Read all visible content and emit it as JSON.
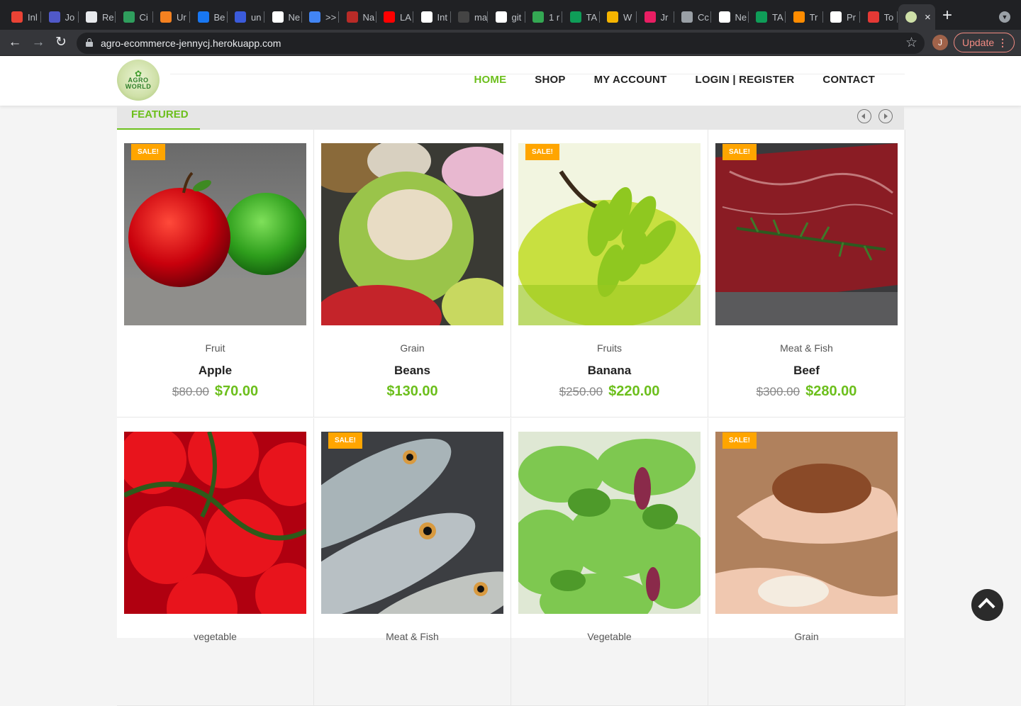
{
  "browser": {
    "tabs": [
      {
        "title": "Inl",
        "color": "#ea4335"
      },
      {
        "title": "Jo",
        "color": "#5059c9"
      },
      {
        "title": "Re",
        "color": "#e8eaed"
      },
      {
        "title": "Ci",
        "color": "#2f9e5d"
      },
      {
        "title": "Ur",
        "color": "#f48120"
      },
      {
        "title": "Be",
        "color": "#1877f2"
      },
      {
        "title": "un",
        "color": "#3b5bdb"
      },
      {
        "title": "Ne",
        "color": "#ffffff"
      },
      {
        "title": ">>",
        "color": "#4285f4"
      },
      {
        "title": "Na",
        "color": "#b92b27"
      },
      {
        "title": "LA",
        "color": "#ff0000"
      },
      {
        "title": "Int",
        "color": "#ffffff"
      },
      {
        "title": "ma",
        "color": "#444444"
      },
      {
        "title": "git",
        "color": "#ffffff"
      },
      {
        "title": "1 r",
        "color": "#34a853"
      },
      {
        "title": "TA",
        "color": "#0f9d58"
      },
      {
        "title": "W",
        "color": "#f5b400"
      },
      {
        "title": "Jr",
        "color": "#e91e63"
      },
      {
        "title": "Cc",
        "color": "#9aa0a6"
      },
      {
        "title": "Ne",
        "color": "#ffffff"
      },
      {
        "title": "TA",
        "color": "#0f9d58"
      },
      {
        "title": "Tr",
        "color": "#ff8c00"
      },
      {
        "title": "Pr",
        "color": "#ffffff"
      },
      {
        "title": "To",
        "color": "#e53935"
      }
    ],
    "active_tab_close": "×",
    "new_tab": "+",
    "url": "agro-ecommerce-jennycj.herokuapp.com",
    "profile_initial": "J",
    "update_label": "Update"
  },
  "site": {
    "logo_line1": "AGRO",
    "logo_line2": "WORLD",
    "nav": [
      {
        "label": "HOME",
        "active": true
      },
      {
        "label": "SHOP",
        "active": false
      },
      {
        "label": "MY ACCOUNT",
        "active": false
      },
      {
        "label": "LOGIN | REGISTER",
        "active": false
      },
      {
        "label": "CONTACT",
        "active": false
      }
    ],
    "accent_color": "#6cbf1c",
    "badge_color": "#ffa500"
  },
  "featured": {
    "tab_label": "FEATURED"
  },
  "products": [
    {
      "category": "Fruit",
      "name": "Apple",
      "old_price": "$80.00",
      "price": "$70.00",
      "sale": true,
      "sale_label": "SALE!",
      "image": "apples"
    },
    {
      "category": "Grain",
      "name": "Beans",
      "old_price": "",
      "price": "$130.00",
      "sale": false,
      "sale_label": "",
      "image": "beans"
    },
    {
      "category": "Fruits",
      "name": "Banana",
      "old_price": "$250.00",
      "price": "$220.00",
      "sale": true,
      "sale_label": "SALE!",
      "image": "bananas"
    },
    {
      "category": "Meat & Fish",
      "name": "Beef",
      "old_price": "$300.00",
      "price": "$280.00",
      "sale": true,
      "sale_label": "SALE!",
      "image": "beef"
    },
    {
      "category": "vegetable",
      "name": "",
      "old_price": "",
      "price": "",
      "sale": false,
      "sale_label": "",
      "image": "tomatoes"
    },
    {
      "category": "Meat & Fish",
      "name": "",
      "old_price": "",
      "price": "",
      "sale": true,
      "sale_label": "SALE!",
      "image": "fish"
    },
    {
      "category": "Vegetable",
      "name": "",
      "old_price": "",
      "price": "",
      "sale": false,
      "sale_label": "",
      "image": "lettuce"
    },
    {
      "category": "Grain",
      "name": "",
      "old_price": "",
      "price": "",
      "sale": true,
      "sale_label": "SALE!",
      "image": "rice"
    }
  ]
}
